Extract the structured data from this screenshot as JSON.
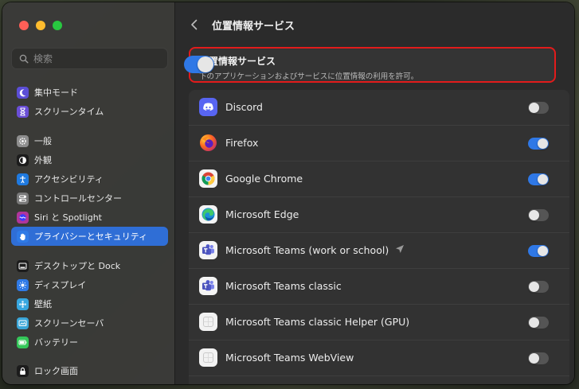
{
  "window": {
    "traffic_lights": {
      "close": "#fe5f57",
      "minimize": "#febc2e",
      "maximize": "#28c840"
    }
  },
  "sidebar": {
    "search_placeholder": "検索",
    "groups": [
      [
        {
          "label": "集中モード",
          "icon": "moon-icon",
          "color": "#5b4ed6"
        },
        {
          "label": "スクリーンタイム",
          "icon": "hourglass-icon",
          "color": "#6a4ed6"
        }
      ],
      [
        {
          "label": "一般",
          "icon": "gear-icon",
          "color": "#8e8e8e"
        },
        {
          "label": "外観",
          "icon": "appearance-icon",
          "color": "#1c1c1c"
        },
        {
          "label": "アクセシビリティ",
          "icon": "accessibility-icon",
          "color": "#1f7ae0"
        },
        {
          "label": "コントロールセンター",
          "icon": "control-center-icon",
          "color": "#7a7a7a"
        },
        {
          "label": "Siri と Spotlight",
          "icon": "siri-icon",
          "color": "#b0359c"
        },
        {
          "label": "プライバシーとセキュリティ",
          "icon": "hand-icon",
          "color": "#2f7ae6",
          "active": true
        }
      ],
      [
        {
          "label": "デスクトップと Dock",
          "icon": "dock-icon",
          "color": "#1c1c1c"
        },
        {
          "label": "ディスプレイ",
          "icon": "sun-icon",
          "color": "#2f7ae6"
        },
        {
          "label": "壁紙",
          "icon": "wallpaper-icon",
          "color": "#37a7e0"
        },
        {
          "label": "スクリーンセーバ",
          "icon": "screensaver-icon",
          "color": "#3aa6d8"
        },
        {
          "label": "バッテリー",
          "icon": "battery-icon",
          "color": "#34c759"
        }
      ],
      [
        {
          "label": "ロック画面",
          "icon": "lock-icon",
          "color": "#1c1c1c"
        }
      ]
    ]
  },
  "main": {
    "title": "位置情報サービス",
    "master": {
      "title": "位置情報サービス",
      "subtitle": "下のアプリケーションおよびサービスに位置情報の利用を許可。",
      "enabled": true
    },
    "apps": [
      {
        "name": "Discord",
        "enabled": false,
        "icon": "discord-icon"
      },
      {
        "name": "Firefox",
        "enabled": true,
        "icon": "firefox-icon"
      },
      {
        "name": "Google Chrome",
        "enabled": true,
        "icon": "chrome-icon"
      },
      {
        "name": "Microsoft Edge",
        "enabled": false,
        "icon": "edge-icon"
      },
      {
        "name": "Microsoft Teams (work or school)",
        "enabled": true,
        "icon": "teams-icon",
        "location_arrow": true
      },
      {
        "name": "Microsoft Teams classic",
        "enabled": false,
        "icon": "teams-icon"
      },
      {
        "name": "Microsoft Teams classic Helper (GPU)",
        "enabled": false,
        "icon": "generic-app-icon"
      },
      {
        "name": "Microsoft Teams WebView",
        "enabled": false,
        "icon": "generic-app-icon"
      }
    ]
  },
  "colors": {
    "accent": "#2f78e6",
    "highlight_border": "#e21b1b"
  }
}
